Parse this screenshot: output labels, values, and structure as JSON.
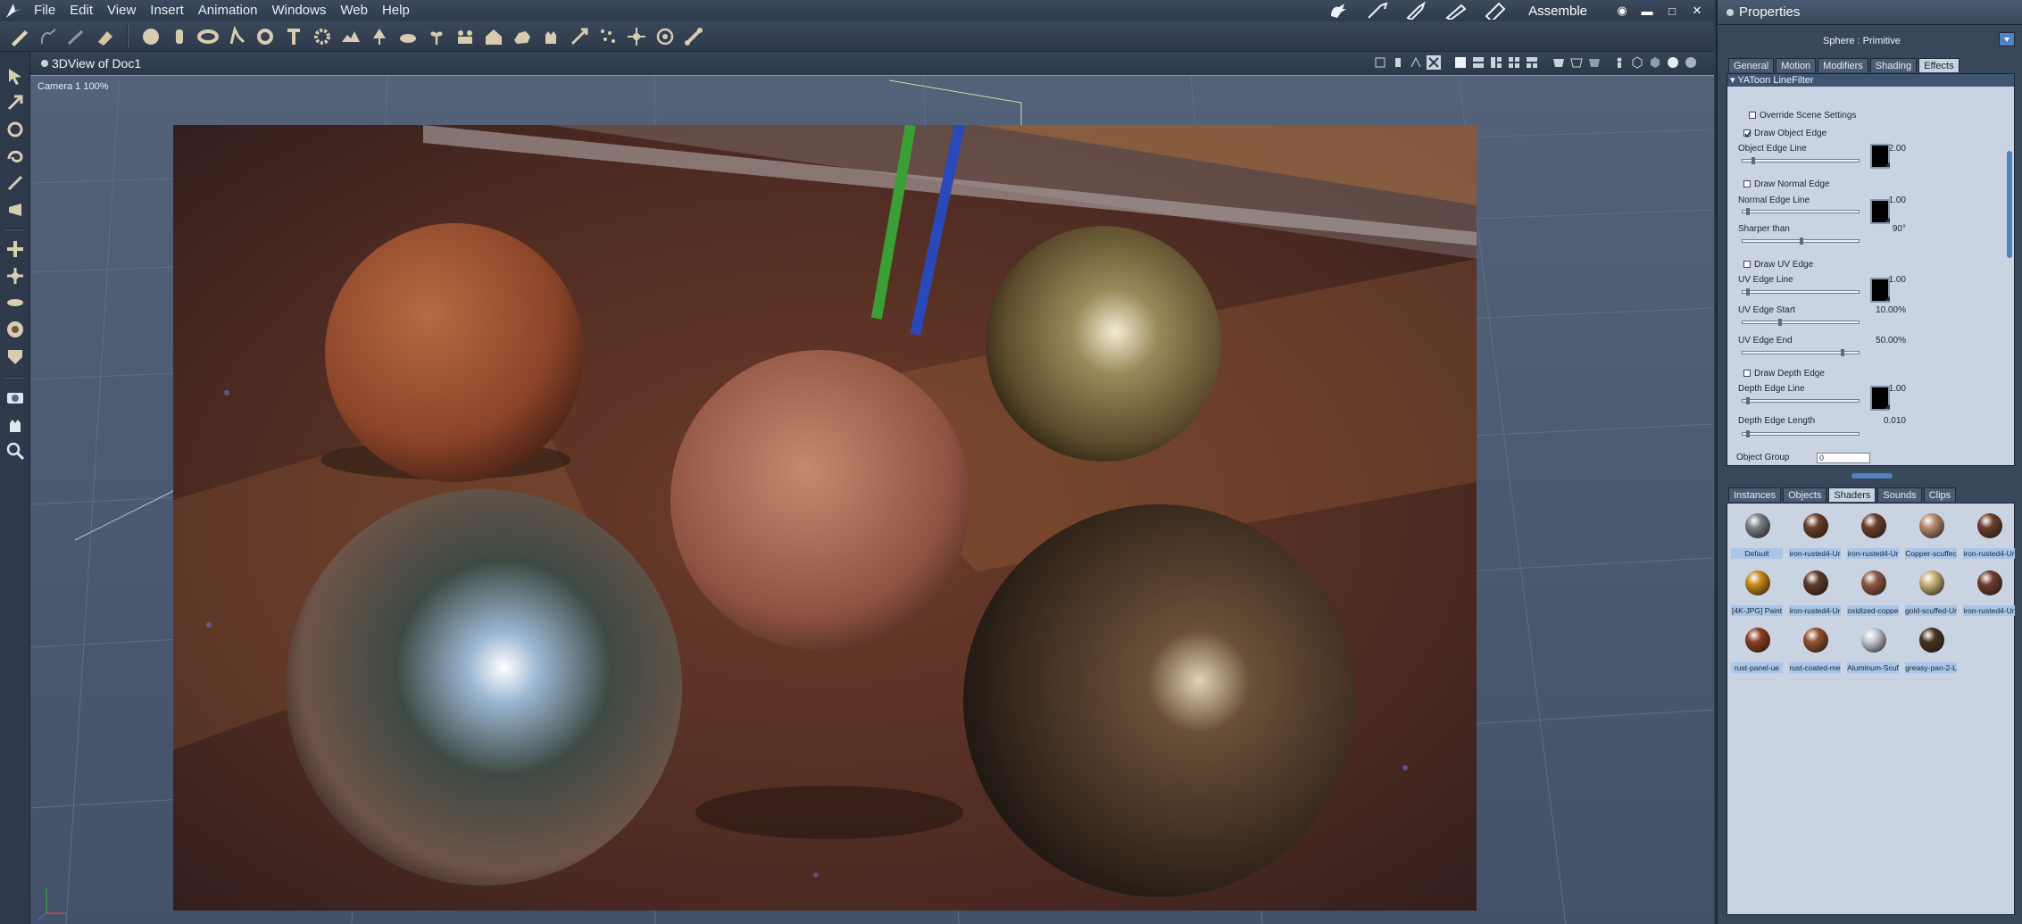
{
  "menubar": {
    "items": [
      "File",
      "Edit",
      "View",
      "Insert",
      "Animation",
      "Windows",
      "Web",
      "Help"
    ],
    "room": "Assemble"
  },
  "viewport": {
    "title": "3DView of Doc1",
    "camera_label": "Camera 1 100%"
  },
  "properties": {
    "title": "Properties",
    "object_name": "Sphere : Primitive",
    "tabs": [
      "General",
      "Motion",
      "Modifiers",
      "Shading",
      "Effects"
    ],
    "active_tab": "Effects",
    "section_title": "YAToon LineFilter",
    "override": "Override Scene Settings",
    "draw_object_edge": "Draw Object Edge",
    "object_edge_line": {
      "label": "Object Edge Line",
      "value": "2.00"
    },
    "draw_normal_edge": "Draw Normal Edge",
    "normal_edge_line": {
      "label": "Normal Edge Line",
      "value": "1.00"
    },
    "sharper_than": {
      "label": "Sharper than",
      "value": "90°"
    },
    "draw_uv_edge": "Draw UV Edge",
    "uv_edge_line": {
      "label": "UV Edge Line",
      "value": "1.00"
    },
    "uv_edge_start": {
      "label": "UV Edge Start",
      "value": "10.00%"
    },
    "uv_edge_end": {
      "label": "UV Edge End",
      "value": "50.00%"
    },
    "draw_depth_edge": "Draw Depth Edge",
    "depth_edge_line": {
      "label": "Depth Edge Line",
      "value": "1.00"
    },
    "depth_edge_length": {
      "label": "Depth Edge Length",
      "value": "0.010"
    },
    "object_group": {
      "label": "Object Group",
      "value": "0"
    }
  },
  "library": {
    "tabs": [
      "Instances",
      "Objects",
      "Shaders",
      "Sounds",
      "Clips"
    ],
    "active_tab": "Shaders",
    "shaders": [
      {
        "label": "Default",
        "color": "#7a7f86"
      },
      {
        "label": "iron-rusted4-Ur",
        "color": "#6b3e2c"
      },
      {
        "label": "iron-rusted4-Ur",
        "color": "#6b3e2c"
      },
      {
        "label": "Copper-scuffec",
        "color": "#b58a6c"
      },
      {
        "label": "iron-rusted4-Ur",
        "color": "#6b3e2c"
      },
      {
        "label": "[4K-JPG] Paint",
        "color": "#c98a1c"
      },
      {
        "label": "iron-rusted4-Ur",
        "color": "#5e3a2a"
      },
      {
        "label": "oxidized-coppe",
        "color": "#8c5a44"
      },
      {
        "label": "gold-scuffed-Ur",
        "color": "#c8b07a"
      },
      {
        "label": "iron-rusted4-Ur",
        "color": "#6b3e2c"
      },
      {
        "label": "rust-panel-ue",
        "color": "#8c3e22"
      },
      {
        "label": "rust-coated-me",
        "color": "#94502e"
      },
      {
        "label": "Aluminum-Scuf",
        "color": "#c5cad4"
      },
      {
        "label": "greasy-pan-2-L",
        "color": "#4a3422"
      }
    ]
  }
}
